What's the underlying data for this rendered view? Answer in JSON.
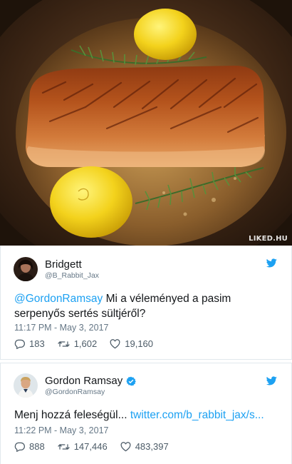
{
  "photo": {
    "watermark": "LIKED.HU",
    "description_icon": "food-photo-salmon-icon"
  },
  "tweets": [
    {
      "display_name": "Bridgett",
      "handle": "@B_Rabbit_Jax",
      "verified": false,
      "text_mention": "@GordonRamsay",
      "text_body": " Mi a véleményed a pasim serpenyős sertés sültjéről?",
      "timestamp": "11:17 PM - May 3, 2017",
      "replies": "183",
      "retweets": "1,602",
      "likes": "19,160"
    },
    {
      "display_name": "Gordon Ramsay",
      "handle": "@GordonRamsay",
      "verified": true,
      "text_body": "Menj hozzá feleségül... ",
      "text_link": "twitter.com/b_rabbit_jax/s...",
      "timestamp": "11:22 PM - May 3, 2017",
      "replies": "888",
      "retweets": "147,446",
      "likes": "483,397"
    }
  ],
  "colors": {
    "twitter_blue": "#1da1f2",
    "text": "#14171a",
    "muted": "#657786",
    "border": "#e1e8ed"
  }
}
